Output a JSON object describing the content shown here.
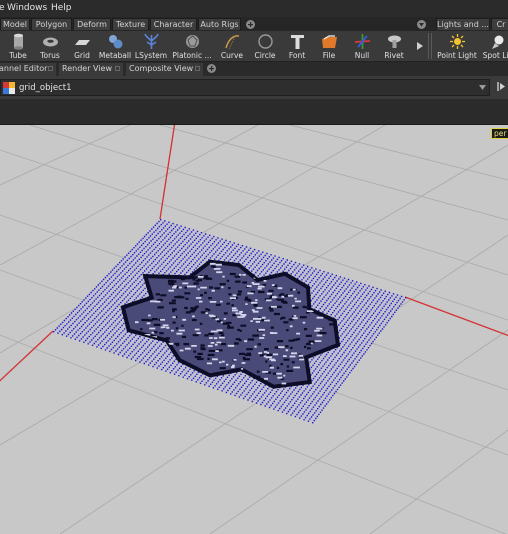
{
  "menu": {
    "left_fragment": "e",
    "items": [
      "Windows",
      "Help"
    ]
  },
  "shelf_tabs": {
    "items": [
      "Model",
      "Polygon",
      "Deform",
      "Texture",
      "Character",
      "Auto Rigs"
    ],
    "right_items": [
      "Lights and ...",
      "Cr"
    ]
  },
  "tools": [
    {
      "label": "Tube",
      "icon": "tube-icon"
    },
    {
      "label": "Torus",
      "icon": "torus-icon"
    },
    {
      "label": "Grid",
      "icon": "grid-icon"
    },
    {
      "label": "Metaball",
      "icon": "metaball-icon"
    },
    {
      "label": "LSystem",
      "icon": "lsystem-icon"
    },
    {
      "label": "Platonic ...",
      "icon": "platonic-icon"
    },
    {
      "label": "Curve",
      "icon": "curve-icon"
    },
    {
      "label": "Circle",
      "icon": "circle-icon"
    },
    {
      "label": "Font",
      "icon": "font-icon"
    },
    {
      "label": "File",
      "icon": "file-icon"
    },
    {
      "label": "Null",
      "icon": "null-icon"
    },
    {
      "label": "Rivet",
      "icon": "rivet-icon"
    }
  ],
  "light_tools": [
    {
      "label": "Point Light",
      "icon": "point-light-icon"
    },
    {
      "label": "Spot Lig",
      "icon": "spot-light-icon"
    }
  ],
  "pane_tabs": [
    "annel Editor",
    "Render View",
    "Composite View"
  ],
  "path": {
    "object": "grid_object1"
  },
  "viewport": {
    "camera_label": "per"
  },
  "colors": {
    "grid_points": "#1d17c8",
    "ink": "#0d0d28",
    "x_axis": "#d23232",
    "background": "#c8c8c8"
  }
}
